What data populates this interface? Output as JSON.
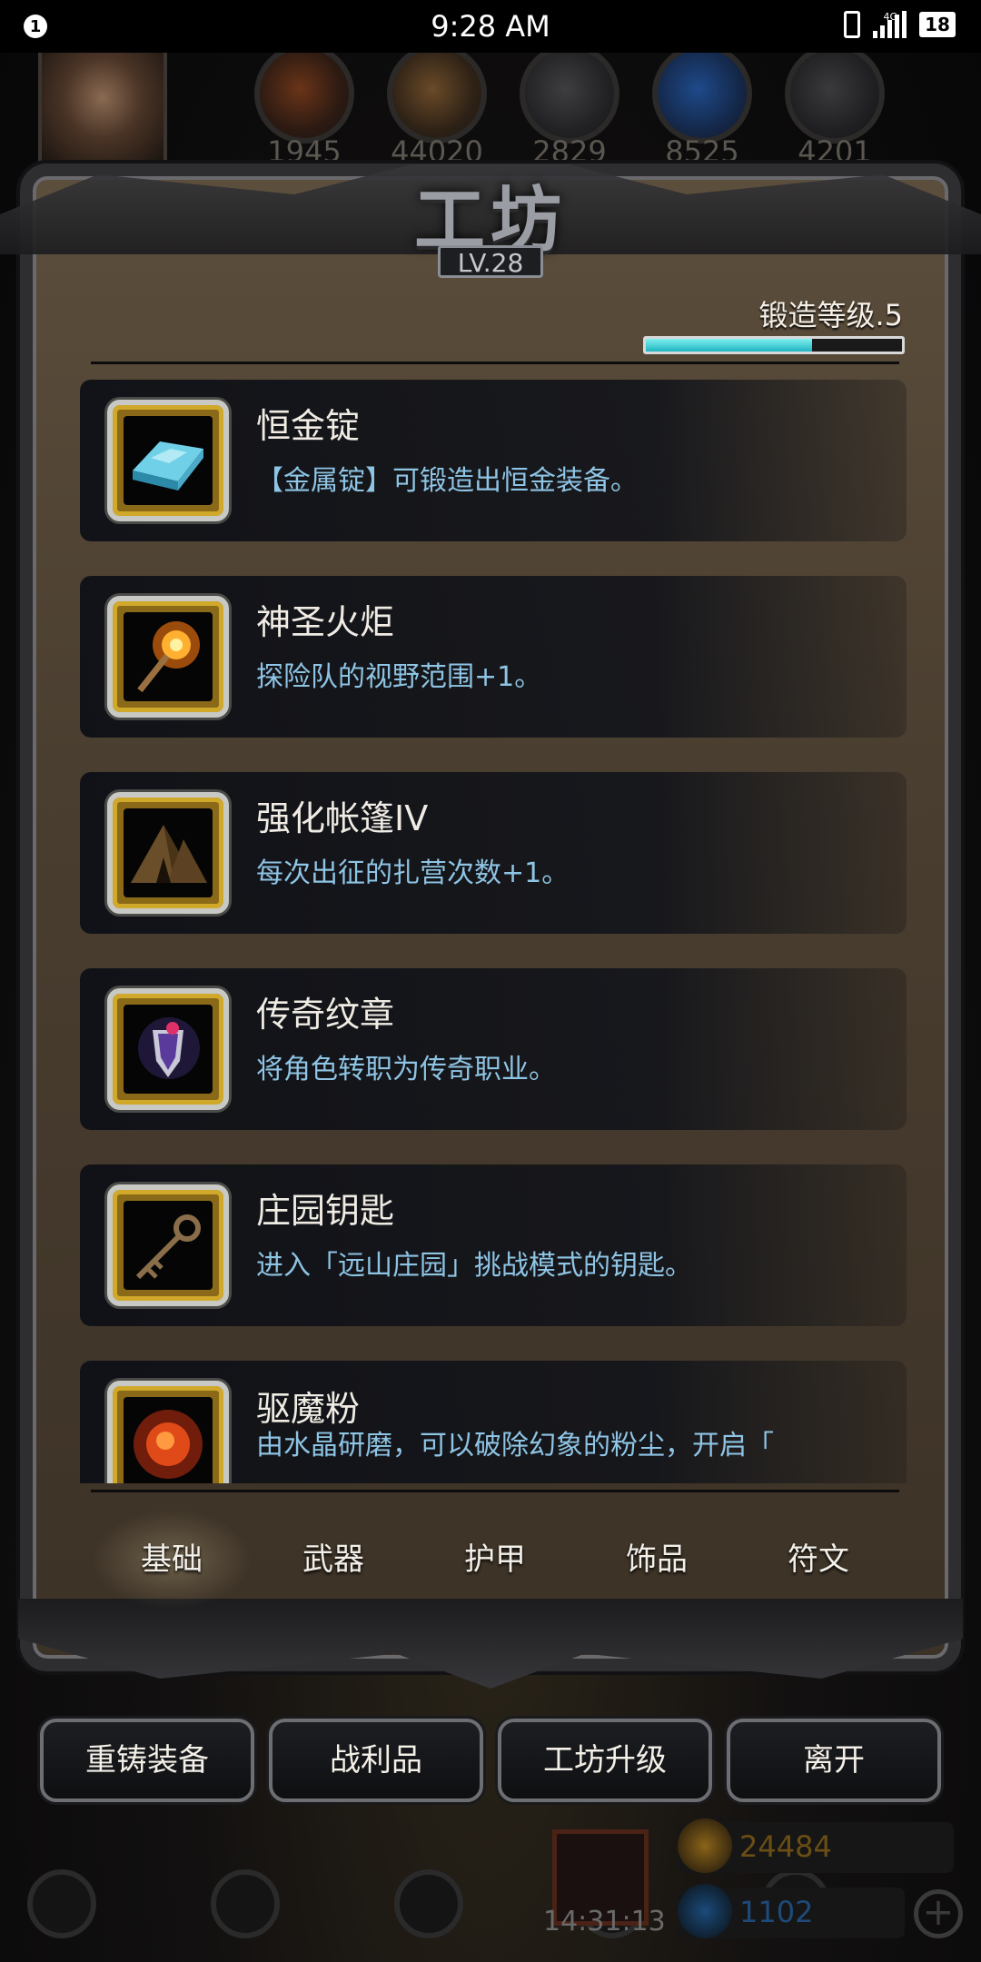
{
  "status": {
    "notification": "1",
    "time": "9:28 AM",
    "network": "4G",
    "battery": "18"
  },
  "resources": [
    "1945",
    "44020",
    "2829",
    "8525",
    "4201"
  ],
  "header": {
    "title": "工坊",
    "level": "LV.28"
  },
  "forge": {
    "label": "锻造等级.5",
    "progress": 0.65
  },
  "items": [
    {
      "name": "恒金锭",
      "desc": "【金属锭】可锻造出恒金装备。",
      "icon": "metal-ingot-icon"
    },
    {
      "name": "神圣火炬",
      "desc": "探险队的视野范围+1。",
      "icon": "torch-icon"
    },
    {
      "name": "强化帐篷IV",
      "desc": "每次出征的扎营次数+1。",
      "icon": "tent-icon"
    },
    {
      "name": "传奇纹章",
      "desc": "将角色转职为传奇职业。",
      "icon": "emblem-icon"
    },
    {
      "name": "庄园钥匙",
      "desc": "进入「远山庄园」挑战模式的钥匙。",
      "icon": "key-icon"
    },
    {
      "name": "驱魔粉",
      "desc": "由水晶研磨，可以破除幻象的粉尘，开启「",
      "icon": "powder-icon"
    }
  ],
  "tabs": [
    "基础",
    "武器",
    "护甲",
    "饰品",
    "符文"
  ],
  "actions": [
    "重铸装备",
    "战利品",
    "工坊升级",
    "离开"
  ],
  "footer": {
    "timer": "14:31:13",
    "gold": "24484",
    "gems": "1102"
  },
  "colors": {
    "accent": "#8ec4e4",
    "progress": "#1fb4c0"
  }
}
